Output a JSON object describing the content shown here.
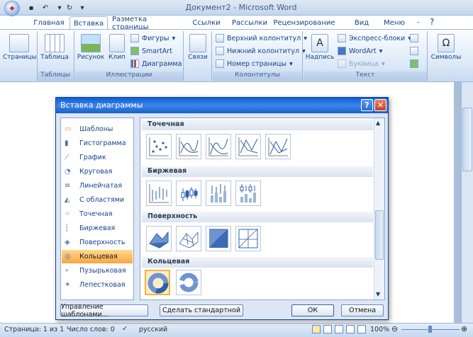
{
  "window": {
    "title": "Документ2 - Microsoft Word"
  },
  "tabs": [
    "Главная",
    "Вставка",
    "Разметка страницы",
    "Ссылки",
    "Рассылки",
    "Рецензирование",
    "Вид",
    "Меню"
  ],
  "ribbon": {
    "pages": "Страницы",
    "table": "Таблица",
    "tables_group": "Таблицы",
    "picture": "Рисунок",
    "clip": "Клип",
    "shapes": "Фигуры",
    "smartart": "SmartArt",
    "chart": "Диаграмма",
    "illustrations_group": "Иллюстрации",
    "links": "Связи",
    "header": "Верхний колонтитул",
    "footer": "Нижний колонтитул",
    "page_number": "Номер страницы",
    "headers_group": "Колонтитулы",
    "textbox": "Надпись",
    "quickparts": "Экспресс-блоки",
    "wordart": "WordArt",
    "dropcap": "Буквица",
    "text_group": "Текст",
    "symbols": "Символы"
  },
  "dialog": {
    "title": "Вставка диаграммы",
    "help": "?",
    "categories": [
      "Шаблоны",
      "Гистограмма",
      "График",
      "Круговая",
      "Линейчатая",
      "С областями",
      "Точечная",
      "Биржевая",
      "Поверхность",
      "Кольцевая",
      "Пузырьковая",
      "Лепестковая"
    ],
    "selected_category": "Кольцевая",
    "sections": [
      "Точечная",
      "Биржевая",
      "Поверхность",
      "Кольцевая"
    ],
    "manage_templates": "Управление шаблонами...",
    "set_default": "Сделать стандартной",
    "ok": "ОК",
    "cancel": "Отмена"
  },
  "status": {
    "page": "Страница: 1 из 1",
    "words": "Число слов: 0",
    "language": "русский",
    "zoom": "100%"
  },
  "colors": {
    "accent": "#15428b",
    "selection": "#f8a540",
    "dialog_title": "#0a5fd6"
  }
}
